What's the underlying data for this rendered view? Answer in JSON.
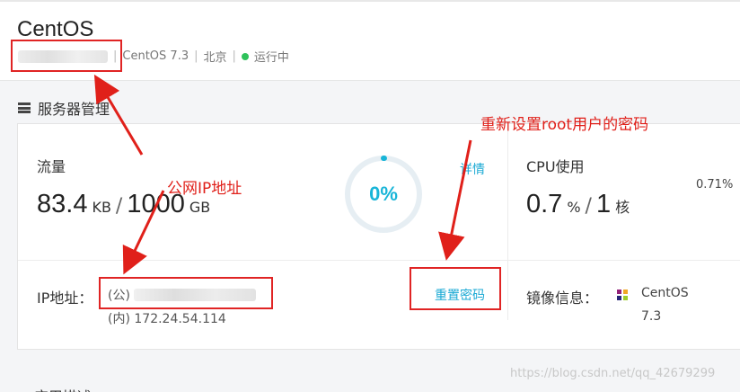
{
  "header": {
    "title": "CentOS",
    "os_version": "CentOS  7.3",
    "region": "北京",
    "status": "运行中",
    "status_color": "#2fc25b"
  },
  "section": {
    "title": "服务器管理"
  },
  "traffic": {
    "label": "流量",
    "used": "83.4",
    "used_unit": "KB",
    "total": "1000",
    "total_unit": "GB",
    "ring_percent": "0%",
    "ring_fraction": 0.0,
    "detail_link": "详情"
  },
  "cpu": {
    "label": "CPU使用",
    "percent_small": "0.71%",
    "usage": "0.7",
    "usage_unit": "%",
    "cores": "1",
    "cores_unit": "核"
  },
  "ip": {
    "label": "IP地址：",
    "public_prefix": "(公)",
    "private": "(内) 172.24.54.114",
    "reset_link": "重置密码"
  },
  "mirror": {
    "label": "镜像信息：",
    "name": "CentOS",
    "version": "7.3",
    "icon": "centos-logo-icon"
  },
  "next_section": {
    "title": "应用描述"
  },
  "annotations": {
    "public_ip": "公网IP地址",
    "reset_root": "重新设置root用户的密码",
    "color": "#e0201a"
  },
  "watermark": "https://blog.csdn.net/qq_42679299",
  "colors": {
    "accent": "#1aa9d4",
    "ring": "#18b5d8"
  }
}
